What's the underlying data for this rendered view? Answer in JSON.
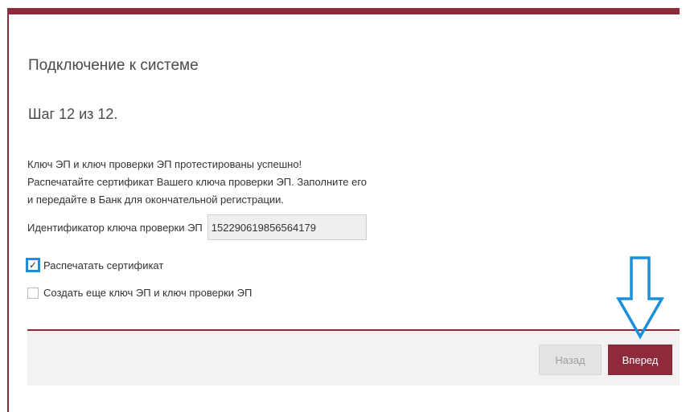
{
  "colors": {
    "brand": "#8e2a3c",
    "highlight": "#1b8fdc",
    "footer_bg": "#f2f2f2"
  },
  "window": {
    "title": "Подключение к системе",
    "step": "Шаг 12 из 12."
  },
  "message": {
    "line1": "Ключ ЭП и ключ проверки ЭП протестированы успешно!",
    "line2": "Распечатайте сертификат Вашего ключа проверки ЭП. Заполните его",
    "line3": "и передайте в Банк для окончательной регистрации."
  },
  "key_field": {
    "label": "Идентификатор ключа проверки ЭП",
    "value": "152290619856564179"
  },
  "options": {
    "print_certificate": {
      "label": "Распечатать сертификат",
      "checked": true,
      "check_glyph": "✓"
    },
    "create_another": {
      "label": "Создать еще ключ ЭП и ключ проверки ЭП",
      "checked": false
    }
  },
  "buttons": {
    "back_label": "Назад",
    "next_label": "Вперед"
  },
  "annotation": {
    "icon": "arrow-down-icon"
  }
}
